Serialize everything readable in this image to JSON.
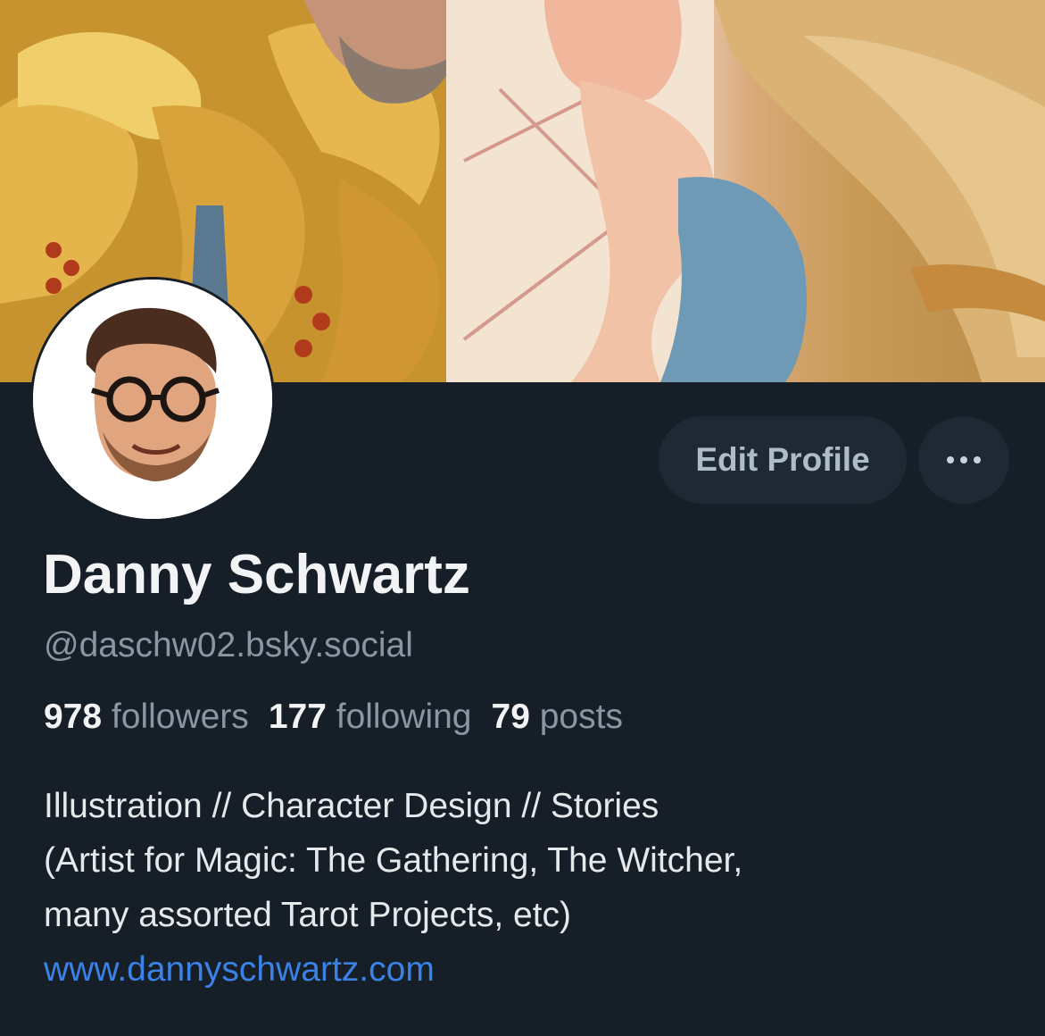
{
  "profile": {
    "display_name": "Danny Schwartz",
    "handle": "@daschw02.bsky.social",
    "stats": {
      "followers_count": "978",
      "followers_label": "followers",
      "following_count": "177",
      "following_label": "following",
      "posts_count": "79",
      "posts_label": "posts"
    },
    "bio": {
      "line1": "Illustration // Character Design // Stories",
      "line2": "(Artist for Magic: The Gathering, The Witcher,",
      "line3": "many assorted Tarot Projects, etc)",
      "website": "www.dannyschwartz.com"
    }
  },
  "actions": {
    "edit_profile_label": "Edit Profile",
    "more_icon": "more-horizontal-icon"
  },
  "colors": {
    "background": "#161e27",
    "button_bg": "#1f2935",
    "link": "#3b82e6",
    "muted_text": "#8a96a3"
  }
}
